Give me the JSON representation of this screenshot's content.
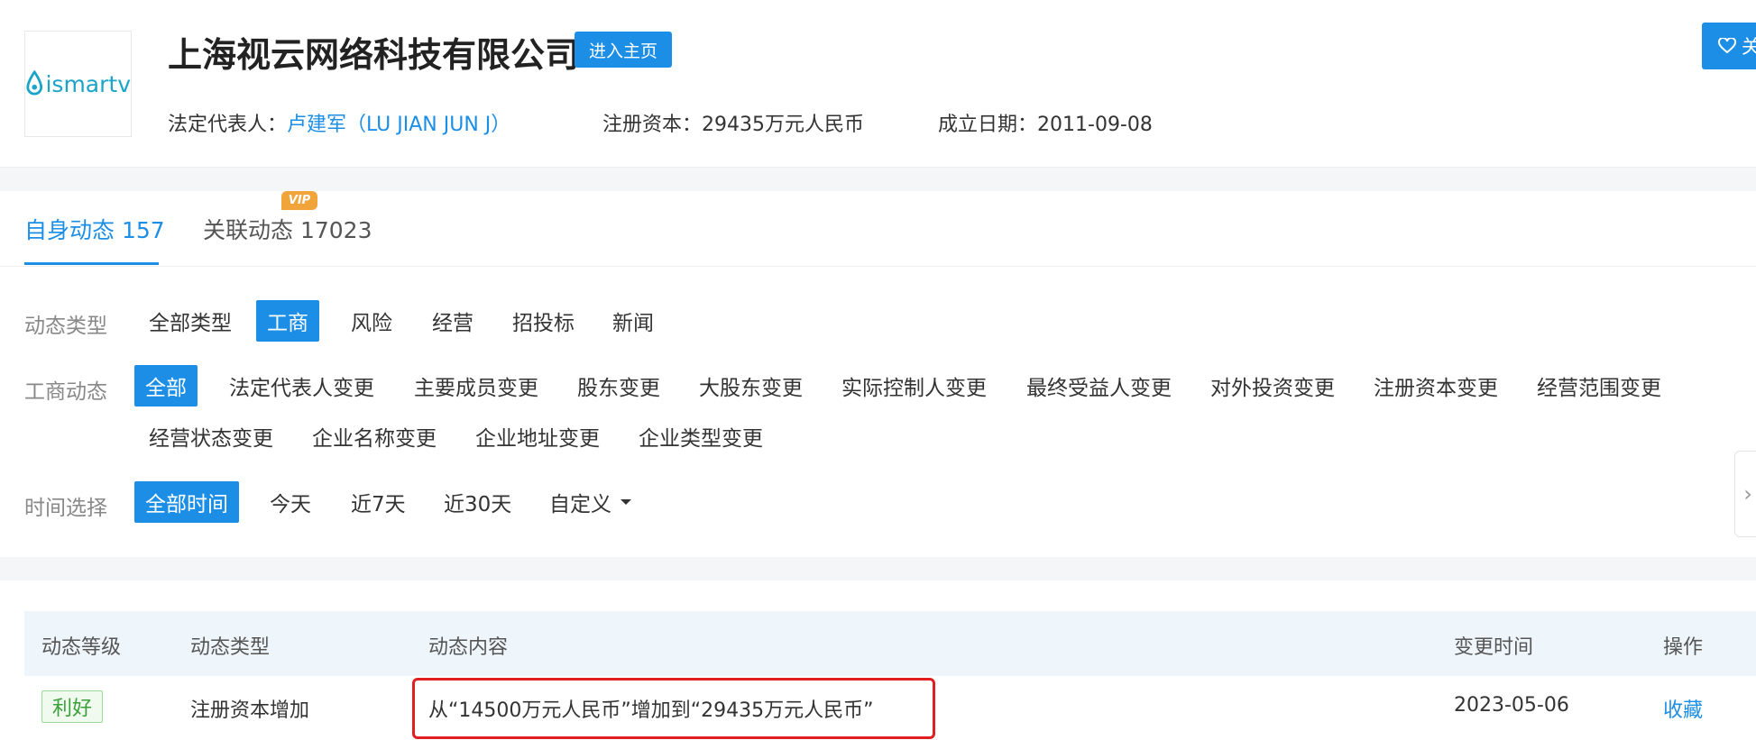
{
  "header": {
    "logo_text": "ismartv",
    "company_name": "上海视云网络科技有限公司",
    "home_button": "进入主页",
    "follow_button": "关",
    "legal_rep_label": "法定代表人：",
    "legal_rep_value": "卢建军（LU JIAN JUN J）",
    "reg_capital_label": "注册资本：",
    "reg_capital_value": "29435万元人民币",
    "est_date_label": "成立日期：",
    "est_date_value": "2011-09-08"
  },
  "tabs": [
    {
      "label": "自身动态 157",
      "active": true
    },
    {
      "label": "关联动态 17023",
      "active": false,
      "badge": "VIP"
    }
  ],
  "filters": {
    "type_label": "动态类型",
    "types": [
      "全部类型",
      "工商",
      "风险",
      "经营",
      "招投标",
      "新闻"
    ],
    "biz_label": "工商动态",
    "biz_row1": [
      "全部",
      "法定代表人变更",
      "主要成员变更",
      "股东变更",
      "大股东变更",
      "实际控制人变更",
      "最终受益人变更",
      "对外投资变更",
      "注册资本变更",
      "经营范围变更"
    ],
    "biz_row2": [
      "经营状态变更",
      "企业名称变更",
      "企业地址变更",
      "企业类型变更"
    ],
    "time_label": "时间选择",
    "times": [
      "全部时间",
      "今天",
      "近7天",
      "近30天",
      "自定义"
    ]
  },
  "table": {
    "headers": [
      "动态等级",
      "动态类型",
      "动态内容",
      "变更时间",
      "操作"
    ],
    "rows": [
      {
        "level": "利好",
        "type": "注册资本增加",
        "content": "从“14500万元人民币”增加到“29435万元人民币”",
        "time": "2023-05-06",
        "action": "收藏"
      }
    ]
  },
  "colors": {
    "accent": "#1d8ee6",
    "vip": "#f0a43a",
    "good": "#3aa03a",
    "highlight": "#e02020"
  }
}
